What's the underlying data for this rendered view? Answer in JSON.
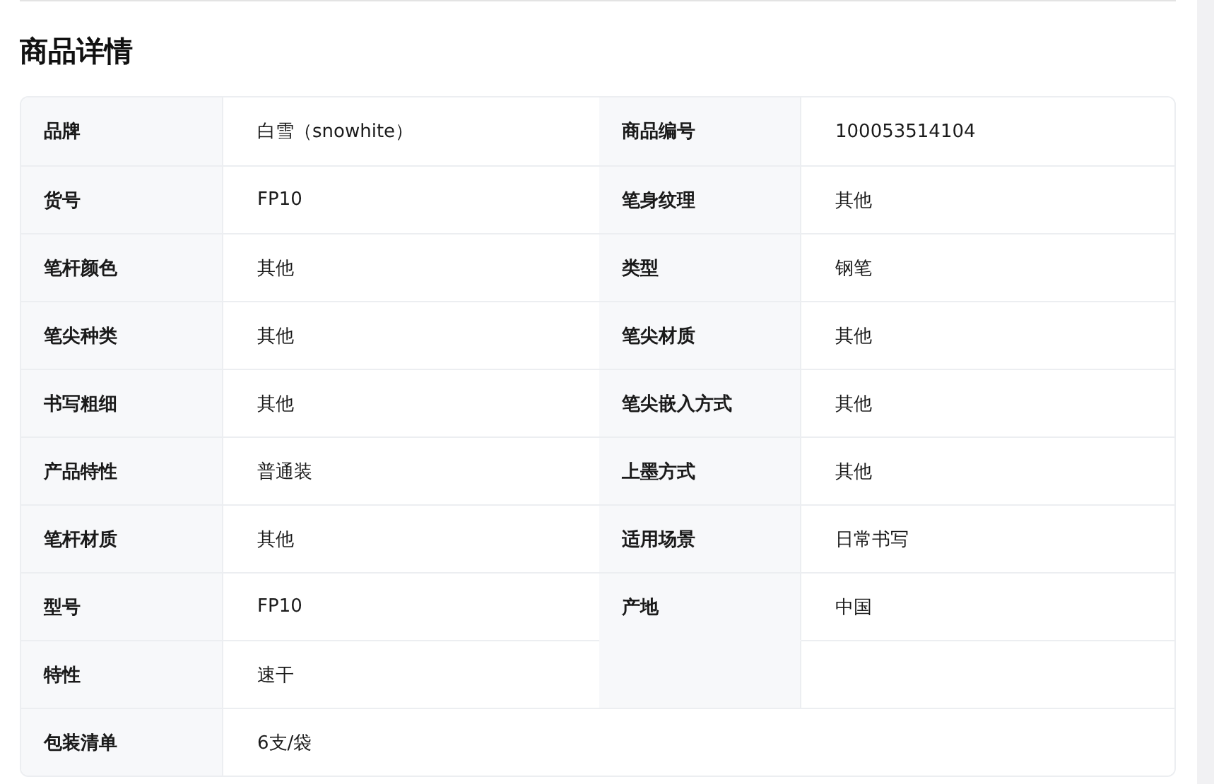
{
  "section": {
    "title": "商品详情"
  },
  "rows": [
    {
      "kind": "half",
      "pairs": [
        {
          "label": "品牌",
          "value": "白雪（snowhite）"
        },
        {
          "label": "商品编号",
          "value": "100053514104"
        }
      ]
    },
    {
      "kind": "half",
      "pairs": [
        {
          "label": "货号",
          "value": "FP10"
        },
        {
          "label": "笔身纹理",
          "value": "其他"
        }
      ]
    },
    {
      "kind": "half",
      "pairs": [
        {
          "label": "笔杆颜色",
          "value": "其他"
        },
        {
          "label": "类型",
          "value": "钢笔"
        }
      ]
    },
    {
      "kind": "half",
      "pairs": [
        {
          "label": "笔尖种类",
          "value": "其他"
        },
        {
          "label": "笔尖材质",
          "value": "其他"
        }
      ]
    },
    {
      "kind": "half",
      "pairs": [
        {
          "label": "书写粗细",
          "value": "其他"
        },
        {
          "label": "笔尖嵌入方式",
          "value": "其他"
        }
      ]
    },
    {
      "kind": "half",
      "pairs": [
        {
          "label": "产品特性",
          "value": "普通装"
        },
        {
          "label": "上墨方式",
          "value": "其他"
        }
      ]
    },
    {
      "kind": "half",
      "pairs": [
        {
          "label": "笔杆材质",
          "value": "其他"
        },
        {
          "label": "适用场景",
          "value": "日常书写"
        }
      ]
    },
    {
      "kind": "half",
      "pairs": [
        {
          "label": "型号",
          "value": "FP10"
        },
        {
          "label": "产地",
          "value": "中国"
        }
      ]
    },
    {
      "kind": "half",
      "pairs": [
        {
          "label": "特性",
          "value": "速干"
        }
      ]
    },
    {
      "kind": "full",
      "pairs": [
        {
          "label": "包装清单",
          "value": "6支/袋"
        }
      ]
    }
  ]
}
